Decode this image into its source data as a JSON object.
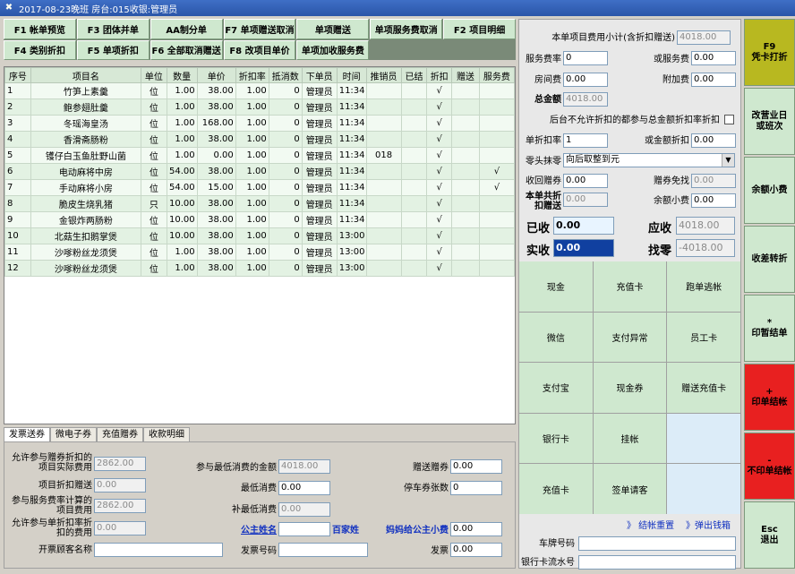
{
  "window": {
    "title": "2017-08-23晚班 房台:015收银:管理员"
  },
  "fkeys": [
    "F1 帐单预览",
    "F3 团体并单",
    "AA制分单",
    "F7 单项赠送取消",
    "单项赠送",
    "单项服务费取消",
    "F2 项目明细",
    "F4 类别折扣",
    "F5 单项折扣",
    "F6 全部取消赠送",
    "F8 改项目单价",
    "单项加收服务费"
  ],
  "grid": {
    "headers": [
      "序号",
      "项目名",
      "单位",
      "数量",
      "单价",
      "折扣率",
      "抵消数",
      "下单员",
      "时间",
      "推销员",
      "已结",
      "折扣",
      "赠送",
      "服务费"
    ],
    "rows": [
      [
        "1",
        "竹笋上素羹",
        "位",
        "1.00",
        "38.00",
        "1.00",
        "0",
        "管理员",
        "11:34",
        "",
        "",
        "√",
        "",
        ""
      ],
      [
        "2",
        "鲍参翅肚羹",
        "位",
        "1.00",
        "38.00",
        "1.00",
        "0",
        "管理员",
        "11:34",
        "",
        "",
        "√",
        "",
        ""
      ],
      [
        "3",
        "冬瑶海皇汤",
        "位",
        "1.00",
        "168.00",
        "1.00",
        "0",
        "管理员",
        "11:34",
        "",
        "",
        "√",
        "",
        ""
      ],
      [
        "4",
        "香滑斋肠粉",
        "位",
        "1.00",
        "38.00",
        "1.00",
        "0",
        "管理员",
        "11:34",
        "",
        "",
        "√",
        "",
        ""
      ],
      [
        "5",
        "镬仔白玉鱼肚野山菌",
        "位",
        "1.00",
        "0.00",
        "1.00",
        "0",
        "管理员",
        "11:34",
        "018",
        "",
        "√",
        "",
        ""
      ],
      [
        "6",
        "电动麻将中房",
        "位",
        "54.00",
        "38.00",
        "1.00",
        "0",
        "管理员",
        "11:34",
        "",
        "",
        "√",
        "",
        "√"
      ],
      [
        "7",
        "手动麻将小房",
        "位",
        "54.00",
        "15.00",
        "1.00",
        "0",
        "管理员",
        "11:34",
        "",
        "",
        "√",
        "",
        "√"
      ],
      [
        "8",
        "脆皮生烧乳猪",
        "只",
        "10.00",
        "38.00",
        "1.00",
        "0",
        "管理员",
        "11:34",
        "",
        "",
        "√",
        "",
        ""
      ],
      [
        "9",
        "金银炸两肠粉",
        "位",
        "10.00",
        "38.00",
        "1.00",
        "0",
        "管理员",
        "11:34",
        "",
        "",
        "√",
        "",
        ""
      ],
      [
        "10",
        "北菇生扣鹅掌煲",
        "位",
        "10.00",
        "38.00",
        "1.00",
        "0",
        "管理员",
        "13:00",
        "",
        "",
        "√",
        "",
        ""
      ],
      [
        "11",
        "沙嗲粉丝龙须煲",
        "位",
        "1.00",
        "38.00",
        "1.00",
        "0",
        "管理员",
        "13:00",
        "",
        "",
        "√",
        "",
        ""
      ],
      [
        "12",
        "沙嗲粉丝龙须煲",
        "位",
        "1.00",
        "38.00",
        "1.00",
        "0",
        "管理员",
        "13:00",
        "",
        "",
        "√",
        "",
        ""
      ]
    ]
  },
  "tabs": [
    "发票送券",
    "微电子券",
    "充值赠券",
    "收款明细"
  ],
  "bottom": {
    "allow_coupon_label": "允许参与赠券折扣的项目实际费用",
    "allow_coupon_value": "2862.00",
    "item_discount_label": "项目折扣赠送",
    "item_discount_value": "0.00",
    "service_calc_label": "参与服务费率计算的项目费用",
    "service_calc_value": "2862.00",
    "allow_single_label": "允许参与单折扣率折扣的费用",
    "allow_single_value": "0.00",
    "invoice_name_label": "开票顾客名称",
    "invoice_name_value": "",
    "min_amount_label": "参与最低消费的金额",
    "min_amount_value": "4018.00",
    "min_consume_label": "最低消费",
    "min_consume_value": "0.00",
    "supplement_label": "补最低消费",
    "supplement_value": "0.00",
    "princess_label": "公主姓名",
    "princess_value": "",
    "baijia_label": "百家姓",
    "invoice_no_label": "发票号码",
    "invoice_no_value": "",
    "gift_coupon_label": "赠送赠券",
    "gift_coupon_value": "0.00",
    "parking_label": "停车券张数",
    "parking_value": "0",
    "tip_label": "妈妈给公主小费",
    "tip_value": "0.00",
    "invoice_label": "发票",
    "invoice_value": "0.00"
  },
  "right": {
    "subtotal_label": "本单项目费用小计(含折扣赠送)",
    "subtotal_value": "4018.00",
    "service_rate_label": "服务费率",
    "service_rate_value": "0",
    "or_service_label": "或服务费",
    "or_service_value": "0.00",
    "room_fee_label": "房间费",
    "room_fee_value": "0.00",
    "extra_fee_label": "附加费",
    "extra_fee_value": "0.00",
    "total_label": "总金额",
    "total_value": "4018.00",
    "no_discount_label": "后台不允许折扣的都参与总金额折扣率折扣",
    "single_rate_label": "单折扣率",
    "single_rate_value": "1",
    "or_amount_discount_label": "或金额折扣",
    "or_amount_discount_value": "0.00",
    "rounding_label": "零头抹零",
    "rounding_value": "向后取整到元",
    "recover_coupon_label": "收回赠券",
    "recover_coupon_value": "0.00",
    "gift_free_label": "赠券免找",
    "gift_free_value": "0.00",
    "total_gift_label": "本单共折扣赠送",
    "total_gift_value": "0.00",
    "balance_tip_label": "余额小费",
    "balance_tip_value": "0.00",
    "received_label": "已收",
    "received_value": "0.00",
    "due_label": "应收",
    "due_value": "4018.00",
    "actual_label": "实收",
    "actual_value": "0.00",
    "change_label": "找零",
    "change_value": "-4018.00",
    "pay_buttons": [
      "现金",
      "充值卡",
      "跑单逃帐",
      "微信",
      "支付异常",
      "员工卡",
      "支付宝",
      "现金券",
      "赠送充值卡",
      "银行卡",
      "挂帐",
      "",
      "充值卡",
      "签单请客",
      ""
    ],
    "reset_label": "》 结帐重置",
    "drawer_label": "》弹出钱箱",
    "plate_label": "车牌号码",
    "plate_value": "",
    "bank_flow_label": "银行卡流水号",
    "bank_flow_value": ""
  },
  "side": [
    {
      "line1": "F9",
      "line2": "凭卡打折",
      "bg": "#b8b820"
    },
    {
      "line1": "改营业日",
      "line2": "或班次",
      "bg": "#cfe8cf"
    },
    {
      "line1": "余额小费",
      "line2": "",
      "bg": "#cfe8cf"
    },
    {
      "line1": "收差转折",
      "line2": "",
      "bg": "#cfe8cf"
    },
    {
      "line1": "*",
      "line2": "印暂结单",
      "bg": "#cfe8cf"
    },
    {
      "line1": "+",
      "line2": "印单结帐",
      "bg": "#e82020"
    },
    {
      "line1": "-",
      "line2": "不印单结帐",
      "bg": "#e82020"
    },
    {
      "line1": "Esc",
      "line2": "退出",
      "bg": "#cfe8cf"
    }
  ]
}
